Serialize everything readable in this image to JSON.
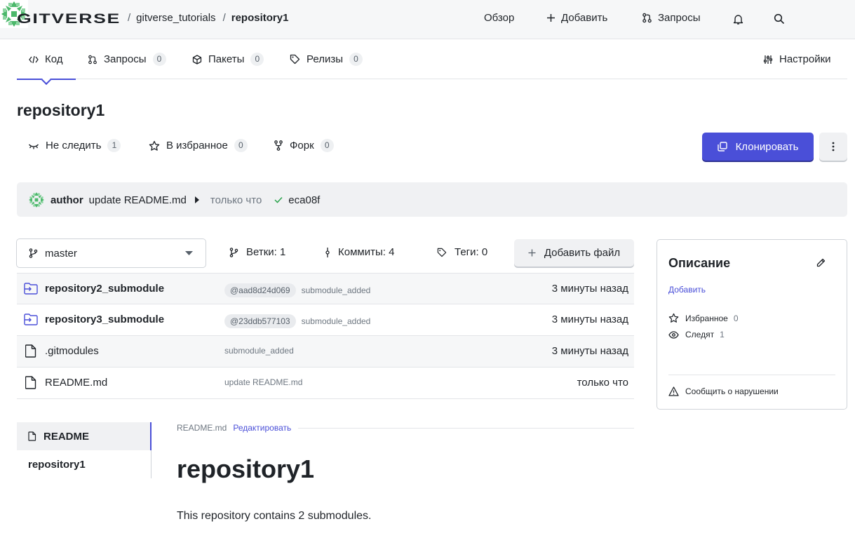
{
  "header": {
    "logo_text": "GITVERSE",
    "breadcrumb": {
      "owner": "gitverse_tutorials",
      "separator": "/",
      "repo": "repository1"
    },
    "nav": {
      "overview": "Обзор",
      "add": "Добавить",
      "requests": "Запросы"
    }
  },
  "tabs": [
    {
      "label": "Код"
    },
    {
      "label": "Запросы",
      "count": "0"
    },
    {
      "label": "Пакеты",
      "count": "0"
    },
    {
      "label": "Релизы",
      "count": "0"
    },
    {
      "label": "Настройки"
    }
  ],
  "repo": {
    "title": "repository1",
    "actions": {
      "unwatch_label": "Не следить",
      "unwatch_count": "1",
      "star_label": "В избранное",
      "star_count": "0",
      "fork_label": "Форк",
      "fork_count": "0"
    },
    "clone_label": "Клонировать"
  },
  "last_commit": {
    "author": "author",
    "message": "update README.md",
    "time": "только что",
    "hash": "eca08f"
  },
  "branch": {
    "current": "master",
    "branches": "Ветки: 1",
    "commits": "Коммиты: 4",
    "tags": "Теги: 0",
    "add_file": "Добавить файл"
  },
  "files": [
    {
      "name": "repository2_submodule",
      "type": "submodule",
      "hash": "@aad8d24d069",
      "commit": "submodule_added",
      "date": "3 минуты назад"
    },
    {
      "name": "repository3_submodule",
      "type": "submodule",
      "hash": "@23ddb577103",
      "commit": "submodule_added",
      "date": "3 минуты назад"
    },
    {
      "name": ".gitmodules",
      "type": "file",
      "commit": "submodule_added",
      "date": "3 минуты назад"
    },
    {
      "name": "README.md",
      "type": "file",
      "commit": "update README.md",
      "date": "только что"
    }
  ],
  "readme": {
    "nav_active": "README",
    "nav_item": "repository1",
    "file_name": "README.md",
    "edit_label": "Редактировать",
    "heading": "repository1",
    "paragraph": "This repository contains 2 submodules."
  },
  "about": {
    "title": "Описание",
    "add_label": "Добавить",
    "favorites_label": "Избранное",
    "favorites_count": "0",
    "watchers_label": "Следят",
    "watchers_count": "1",
    "report_label": "Сообщить о нарушении"
  },
  "colors": {
    "accent": "#4a4fd8",
    "submodule_icon": "#4a4fd8",
    "check": "#2da44e",
    "avatar": "#4cb86b"
  }
}
